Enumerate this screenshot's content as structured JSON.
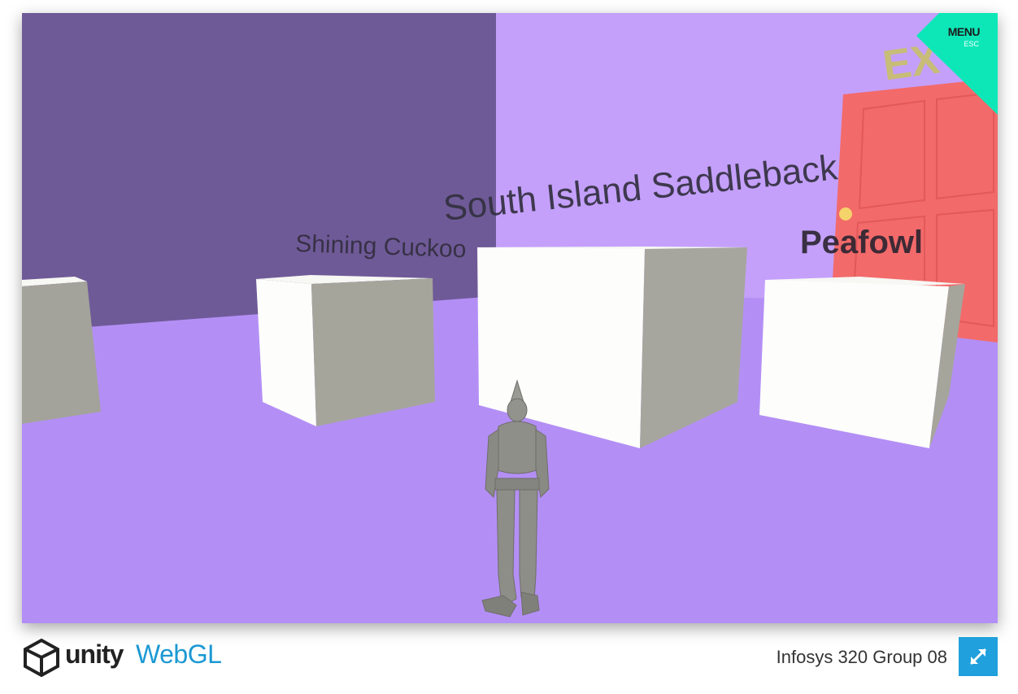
{
  "scene": {
    "labels": {
      "shining_cuckoo": "Shining Cuckoo",
      "south_island_saddleback": "South Island Saddleback",
      "peafowl": "Peafowl",
      "exit_sign": "EX"
    }
  },
  "menu": {
    "label": "MENU",
    "shortcut": "ESC"
  },
  "footer": {
    "unity_word": "unity",
    "webgl_word": "WebGL",
    "project_title": "Infosys 320 Group 08"
  },
  "icons": {
    "unity_logo": "unity-logo-icon",
    "fullscreen": "fullscreen-icon"
  },
  "colors": {
    "floor": "#b38ff5",
    "back_wall": "#c4a0fb",
    "side_wall": "#6f5a98",
    "door": "#f36a6a",
    "menu_corner": "#0de7b8",
    "webgl_blue": "#1c99d3",
    "fullscreen_bg": "#20a0dc"
  }
}
